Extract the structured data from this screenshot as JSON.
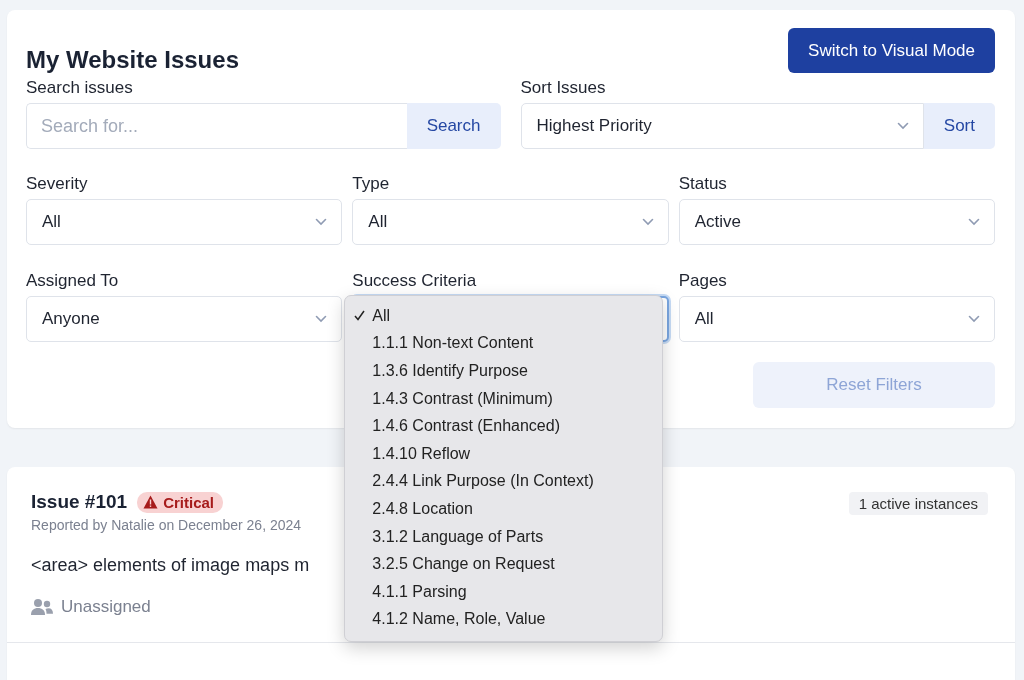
{
  "header": {
    "title": "My Website Issues",
    "mode_button": "Switch to Visual Mode"
  },
  "search": {
    "label": "Search issues",
    "placeholder": "Search for...",
    "button": "Search"
  },
  "sort": {
    "label": "Sort Issues",
    "value": "Highest Priority",
    "button": "Sort"
  },
  "filters": [
    {
      "label": "Severity",
      "value": "All",
      "focused": false
    },
    {
      "label": "Type",
      "value": "All",
      "focused": false
    },
    {
      "label": "Status",
      "value": "Active",
      "focused": false
    },
    {
      "label": "Assigned To",
      "value": "Anyone",
      "focused": false
    },
    {
      "label": "Success Criteria",
      "focused": true,
      "menu": [
        {
          "label": "All",
          "selected": true
        },
        {
          "label": "1.1.1 Non-text Content",
          "selected": false
        },
        {
          "label": "1.3.6 Identify Purpose",
          "selected": false
        },
        {
          "label": "1.4.3 Contrast (Minimum)",
          "selected": false
        },
        {
          "label": "1.4.6 Contrast (Enhanced)",
          "selected": false
        },
        {
          "label": "1.4.10 Reflow",
          "selected": false
        },
        {
          "label": "2.4.4 Link Purpose (In Context)",
          "selected": false
        },
        {
          "label": "2.4.8 Location",
          "selected": false
        },
        {
          "label": "3.1.2 Language of Parts",
          "selected": false
        },
        {
          "label": "3.2.5 Change on Request",
          "selected": false
        },
        {
          "label": "4.1.1 Parsing",
          "selected": false
        },
        {
          "label": "4.1.2 Name, Role, Value",
          "selected": false
        }
      ]
    },
    {
      "label": "Pages",
      "value": "All",
      "focused": false
    }
  ],
  "reset_button": {
    "label": "Reset Filters",
    "disabled": true
  },
  "issue": {
    "title": "Issue #101",
    "severity": {
      "label": "Critical",
      "color": "#a61b1b"
    },
    "reported": "Reported by Natalie on December 26, 2024",
    "instances": "1 active instances",
    "description": "<area> elements of image maps m",
    "assignee": "Unassigned"
  }
}
